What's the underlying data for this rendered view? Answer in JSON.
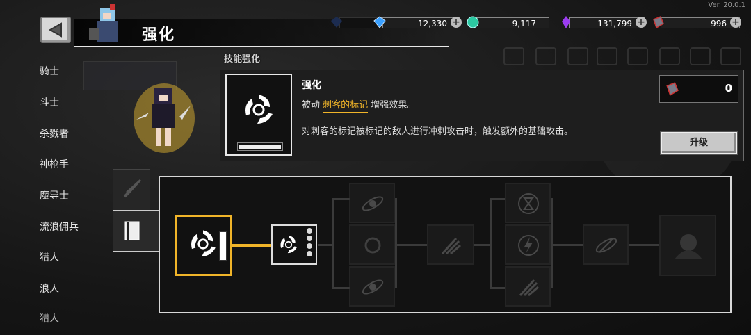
{
  "version": "Ver. 20.0.1",
  "header": {
    "title": "强化"
  },
  "currencies": [
    {
      "name": "blue-gem",
      "value": "12,330"
    },
    {
      "name": "green-orb",
      "value": "9,117"
    },
    {
      "name": "purple-crystal",
      "value": "131,799"
    },
    {
      "name": "upgrade-stone",
      "value": "996"
    }
  ],
  "sidebar": {
    "items": [
      {
        "label": "骑士"
      },
      {
        "label": "斗士"
      },
      {
        "label": "杀戮者"
      },
      {
        "label": "神枪手"
      },
      {
        "label": "魔导士"
      },
      {
        "label": "流浪佣兵"
      },
      {
        "label": "猎人"
      },
      {
        "label": "浪人"
      },
      {
        "label": "猎人"
      }
    ]
  },
  "panel_label": "技能强化",
  "skill": {
    "name": "强化",
    "type": "被动",
    "highlight": "刺客的标记",
    "suffix": "增强效果。",
    "description": "对刺客的标记被标记的敌人进行冲刺攻击时，触发额外的基础攻击。"
  },
  "cost": {
    "value": "0"
  },
  "upgrade_button": "升级",
  "colors": {
    "accent": "#f0b429",
    "panel": "#1e1e1e"
  }
}
